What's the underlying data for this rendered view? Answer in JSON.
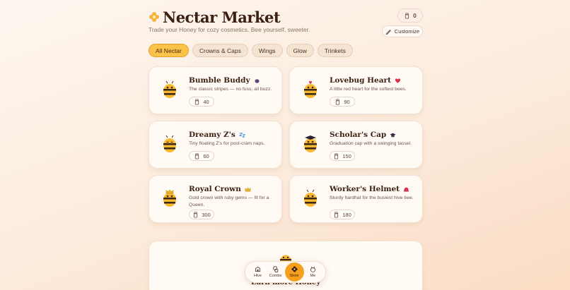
{
  "header": {
    "title": "Nectar Market",
    "subtitle": "Trade your Honey for cozy cosmetics. Bee yourself, sweeter.",
    "balance": "0",
    "customize_label": "Customize"
  },
  "tabs": [
    "All Nectar",
    "Crowns & Caps",
    "Wings",
    "Glow",
    "Trinkets"
  ],
  "active_tab": "All Nectar",
  "items": [
    {
      "name": "Bumble Buddy",
      "badge": "bee-icon",
      "desc": "The classic stripes — no fuss, all buzz.",
      "price": "40"
    },
    {
      "name": "Lovebug Heart",
      "badge": "heart-icon",
      "desc": "A little red heart for the softest bees.",
      "price": "90"
    },
    {
      "name": "Dreamy Z's",
      "badge": "zzz-icon",
      "desc": "Tiny floating Z's for post-cram naps.",
      "price": "60"
    },
    {
      "name": "Scholar's Cap",
      "badge": "grad-cap-icon",
      "desc": "Graduation cap with a swinging tassel.",
      "price": "150"
    },
    {
      "name": "Royal Crown",
      "badge": "crown-icon",
      "desc": "Gold crown with ruby gems — fit for a Queen.",
      "price": "300"
    },
    {
      "name": "Worker's Helmet",
      "badge": "helmet-icon",
      "desc": "Sturdy hardhat for the busiest hive bee.",
      "price": "180"
    }
  ],
  "promo": {
    "title": "Earn more Honey"
  },
  "nav": [
    {
      "label": "Hive",
      "icon": "hive-icon"
    },
    {
      "label": "Combs",
      "icon": "combs-icon"
    },
    {
      "label": "Store",
      "icon": "store-icon"
    },
    {
      "label": "Me",
      "icon": "me-icon"
    }
  ],
  "colors": {
    "accent": "#fbc34a",
    "nav_active": "#f59f1b",
    "title": "#3b1f12"
  }
}
